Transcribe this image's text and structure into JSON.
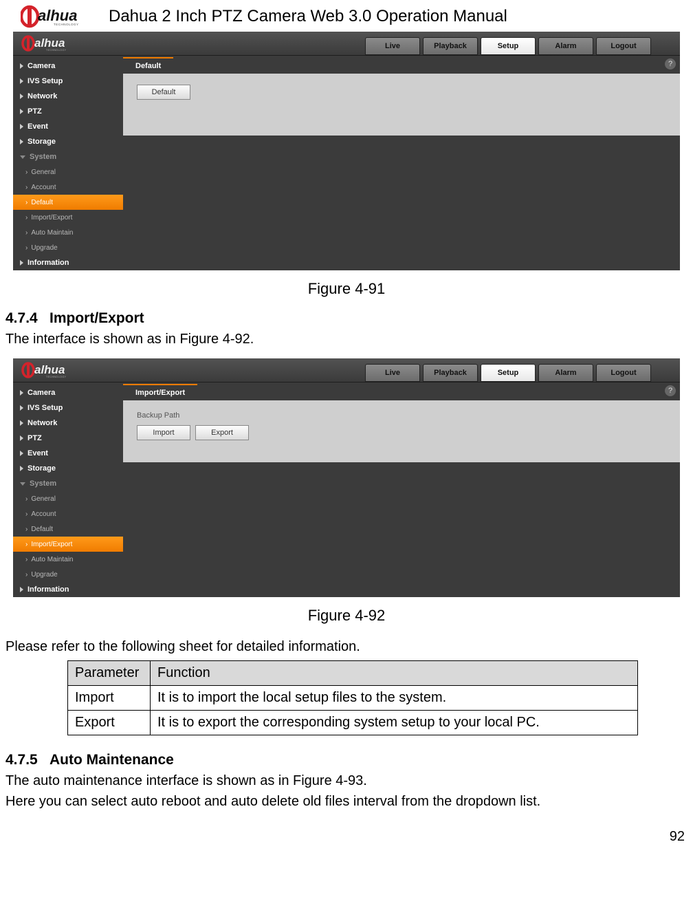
{
  "doc": {
    "header_title": "Dahua 2 Inch PTZ Camera Web 3.0 Operation Manual",
    "figure_91": "Figure 4-91",
    "figure_92": "Figure 4-92",
    "section_474_num": "4.7.4",
    "section_474_title": "Import/Export",
    "section_474_text": "The interface is shown as in Figure 4-92.",
    "section_475_num": "4.7.5",
    "section_475_title": "Auto Maintenance",
    "section_475_text1": "The auto maintenance interface is shown as in Figure 4-93.",
    "section_475_text2": "Here you can select auto reboot and auto delete old files interval from the dropdown list.",
    "table_intro": "Please refer to the following sheet for detailed information.",
    "page_number": "92"
  },
  "param_table": {
    "headers": {
      "param": "Parameter",
      "func": "Function"
    },
    "rows": [
      {
        "param": "Import",
        "func": "It is to import the local setup files to the system."
      },
      {
        "param": "Export",
        "func": "It is to export the corresponding system setup to your local PC."
      }
    ]
  },
  "ui": {
    "logo_text": "alhua",
    "logo_sub": "TECHNOLOGY",
    "top_tabs": {
      "live": "Live",
      "playback": "Playback",
      "setup": "Setup",
      "alarm": "Alarm",
      "logout": "Logout"
    },
    "sidebar": {
      "camera": "Camera",
      "ivs": "IVS Setup",
      "network": "Network",
      "ptz": "PTZ",
      "event": "Event",
      "storage": "Storage",
      "system": "System",
      "general": "General",
      "account": "Account",
      "default": "Default",
      "import_export": "Import/Export",
      "auto_maintain": "Auto Maintain",
      "upgrade": "Upgrade",
      "information": "Information"
    },
    "help_icon": "?"
  },
  "shot1": {
    "content_tab": "Default",
    "button_default": "Default"
  },
  "shot2": {
    "content_tab": "Import/Export",
    "label_backup_path": "Backup Path",
    "button_import": "Import",
    "button_export": "Export"
  }
}
